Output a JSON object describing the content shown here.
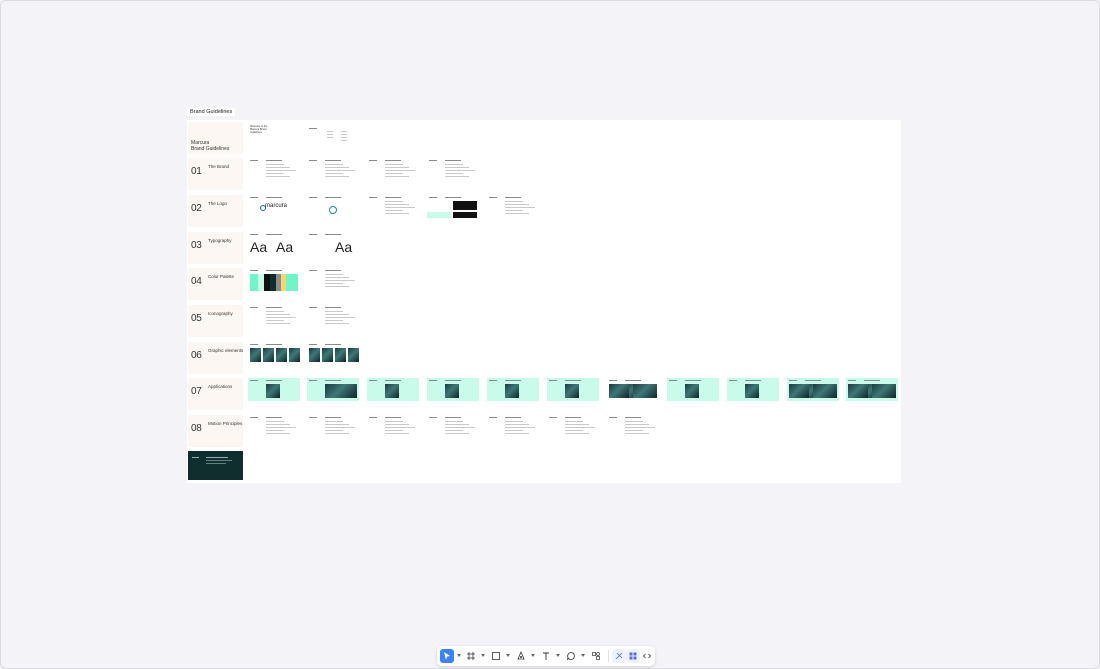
{
  "frame": {
    "title": "Brand Guidelines"
  },
  "intro": {
    "title_line1": "Marcura",
    "title_line2": "Brand Guidelines",
    "welcome": "Welcome to the Marcura Brand Guidelines"
  },
  "sections": [
    {
      "num": "01",
      "title": "The Brand"
    },
    {
      "num": "02",
      "title": "The Logo"
    },
    {
      "num": "03",
      "title": "Typography"
    },
    {
      "num": "04",
      "title": "Color Palette"
    },
    {
      "num": "05",
      "title": "Iconography"
    },
    {
      "num": "06",
      "title": "Graphic elements"
    },
    {
      "num": "07",
      "title": "Applications"
    },
    {
      "num": "08",
      "title": "Motion Principles"
    }
  ],
  "logo": {
    "wordmark": "marcura"
  },
  "typography": {
    "sample1": "Aa",
    "sample2": "Aa"
  },
  "colors": {
    "aqua": "#c8fbea",
    "dark_teal": "#0f2f2f",
    "black": "#111111",
    "gray": "#8c8c8c",
    "yellow": "#f5d76e",
    "mint": "#6ff5c8"
  },
  "toolbar": {
    "tools": [
      {
        "name": "move-tool",
        "active": true
      },
      {
        "name": "frame-tool"
      },
      {
        "name": "shape-tool"
      },
      {
        "name": "pen-tool"
      },
      {
        "name": "text-tool"
      },
      {
        "name": "comment-tool"
      },
      {
        "name": "actions-tool"
      },
      {
        "name": "design-mode"
      },
      {
        "name": "dev-mode"
      },
      {
        "name": "code-mode"
      }
    ]
  }
}
